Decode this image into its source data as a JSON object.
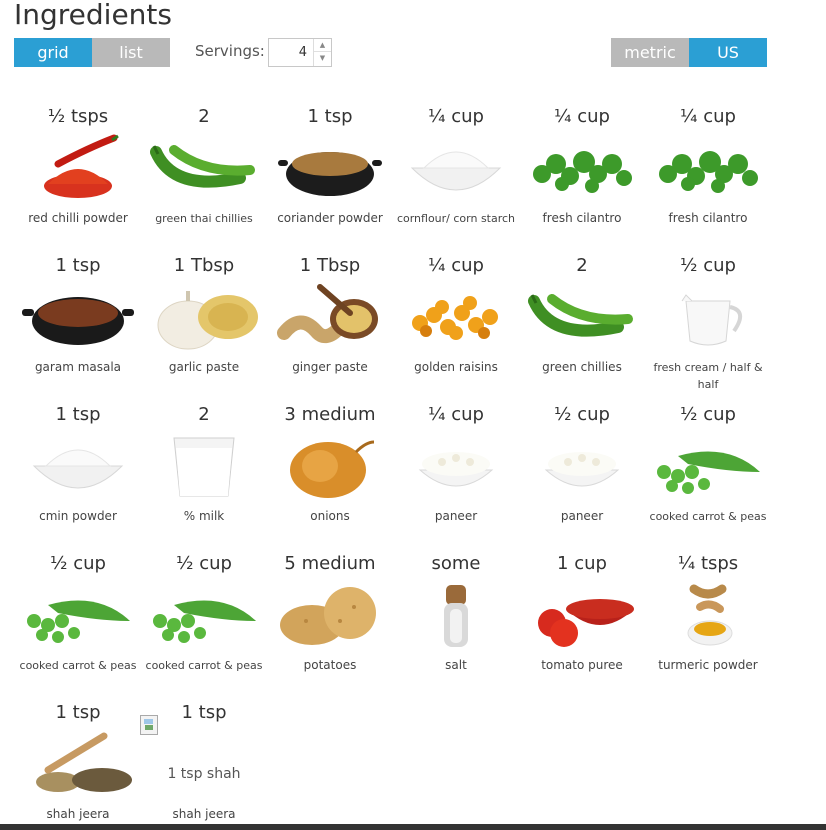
{
  "header": {
    "title": "Ingredients"
  },
  "view_toggle": {
    "grid_label": "grid",
    "list_label": "list",
    "active": "grid"
  },
  "servings": {
    "label": "Servings:",
    "value": "4"
  },
  "unit_toggle": {
    "metric_label": "metric",
    "us_label": "US",
    "active": "US"
  },
  "colors": {
    "accent": "#2b9fd4",
    "inactive": "#b9b9b9"
  },
  "ingredients": [
    {
      "qty": "½ tsps",
      "name": "red chilli powder",
      "icon": "red-chilli-powder"
    },
    {
      "qty": "2",
      "name": "green thai chillies",
      "icon": "green-chillies"
    },
    {
      "qty": "1 tsp",
      "name": "coriander powder",
      "icon": "coriander-powder"
    },
    {
      "qty": "¼ cup",
      "name": "cornflour/ corn starch",
      "icon": "white-powder-bowl"
    },
    {
      "qty": "¼ cup",
      "name": "fresh cilantro",
      "icon": "cilantro"
    },
    {
      "qty": "¼ cup",
      "name": "fresh cilantro",
      "icon": "cilantro"
    },
    {
      "qty": "1 tsp",
      "name": "garam masala",
      "icon": "garam-masala"
    },
    {
      "qty": "1 Tbsp",
      "name": "garlic paste",
      "icon": "garlic"
    },
    {
      "qty": "1 Tbsp",
      "name": "ginger paste",
      "icon": "ginger"
    },
    {
      "qty": "¼ cup",
      "name": "golden raisins",
      "icon": "raisins"
    },
    {
      "qty": "2",
      "name": "green chillies",
      "icon": "green-chillies"
    },
    {
      "qty": "½ cup",
      "name": "fresh cream / half & half",
      "icon": "cream-jug"
    },
    {
      "qty": "1 tsp",
      "name": "cmin powder",
      "icon": "white-powder-bowl"
    },
    {
      "qty": "2",
      "name": "% milk",
      "icon": "milk-glass"
    },
    {
      "qty": "3 medium",
      "name": "onions",
      "icon": "onion"
    },
    {
      "qty": "¼ cup",
      "name": "paneer",
      "icon": "paneer"
    },
    {
      "qty": "½ cup",
      "name": "paneer",
      "icon": "paneer"
    },
    {
      "qty": "½ cup",
      "name": "cooked carrot & peas",
      "icon": "peas"
    },
    {
      "qty": "½ cup",
      "name": "cooked carrot & peas",
      "icon": "peas"
    },
    {
      "qty": "½ cup",
      "name": "cooked carrot & peas",
      "icon": "peas"
    },
    {
      "qty": "5 medium",
      "name": "potatoes",
      "icon": "potatoes"
    },
    {
      "qty": "some",
      "name": "salt",
      "icon": "salt-shaker"
    },
    {
      "qty": "1 cup",
      "name": "tomato puree",
      "icon": "tomato-puree"
    },
    {
      "qty": "¼ tsps",
      "name": "turmeric powder",
      "icon": "turmeric"
    },
    {
      "qty": "1 tsp",
      "name": "shah jeera",
      "icon": "shah-jeera"
    },
    {
      "qty": "1 tsp",
      "name": "shah jeera",
      "icon": "broken-image",
      "alt": "1 tsp shah"
    }
  ]
}
